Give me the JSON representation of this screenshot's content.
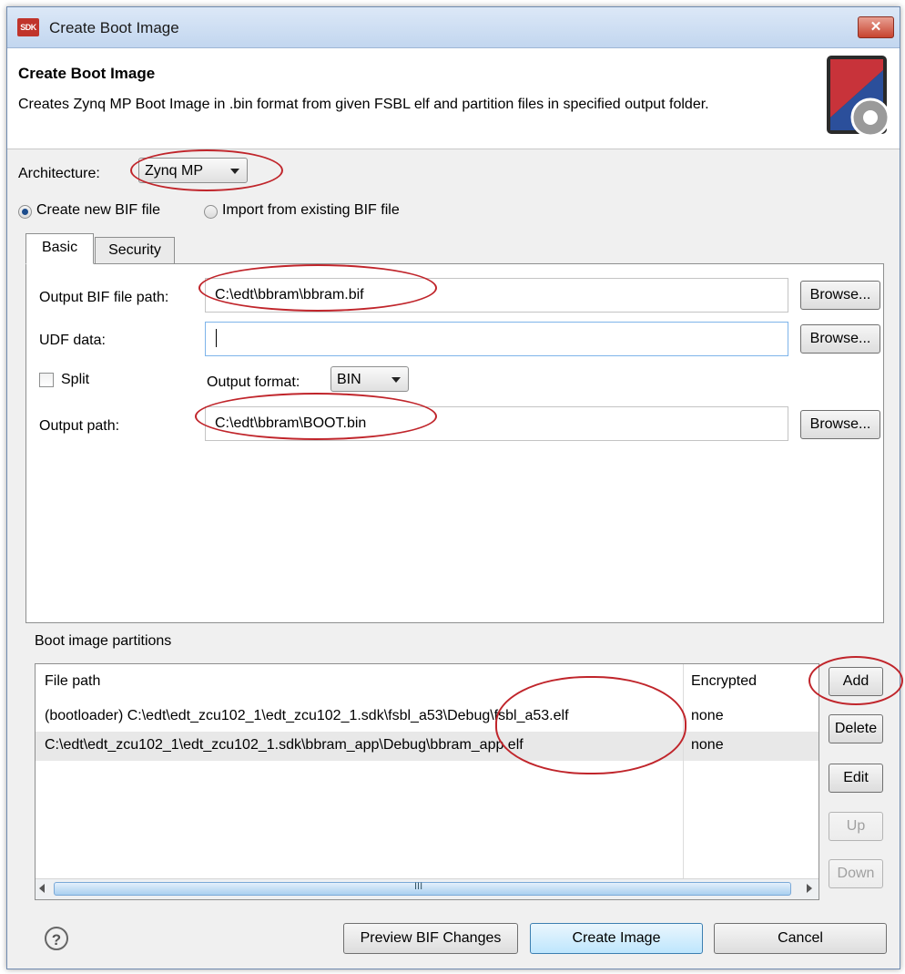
{
  "window": {
    "title": "Create Boot Image",
    "close_label": "✕",
    "app_icon_label": "SDK"
  },
  "header": {
    "title": "Create Boot Image",
    "description": "Creates Zynq MP Boot Image in .bin format from given FSBL elf and partition files in specified output folder."
  },
  "architecture": {
    "label": "Architecture:",
    "value": "Zynq MP"
  },
  "bif_mode": {
    "options": [
      {
        "label": "Create new BIF file",
        "selected": true
      },
      {
        "label": "Import from existing BIF file",
        "selected": false
      }
    ]
  },
  "tabs": [
    {
      "label": "Basic",
      "active": true
    },
    {
      "label": "Security",
      "active": false
    }
  ],
  "basic": {
    "output_bif": {
      "label": "Output BIF file path:",
      "value": "C:\\edt\\bbram\\bbram.bif",
      "browse": "Browse..."
    },
    "udf": {
      "label": "UDF data:",
      "value": "",
      "browse": "Browse..."
    },
    "split": {
      "label": "Split",
      "checked": false
    },
    "output_format": {
      "label": "Output format:",
      "value": "BIN"
    },
    "output_path": {
      "label": "Output path:",
      "value": "C:\\edt\\bbram\\BOOT.bin",
      "browse": "Browse..."
    }
  },
  "partitions": {
    "section_label": "Boot image partitions",
    "columns": [
      "File path",
      "Encrypted"
    ],
    "rows": [
      {
        "path": "(bootloader) C:\\edt\\edt_zcu102_1\\edt_zcu102_1.sdk\\fsbl_a53\\Debug\\fsbl_a53.elf",
        "encrypted": "none"
      },
      {
        "path": "C:\\edt\\edt_zcu102_1\\edt_zcu102_1.sdk\\bbram_app\\Debug\\bbram_app.elf",
        "encrypted": "none"
      }
    ],
    "buttons": {
      "add": "Add",
      "delete": "Delete",
      "edit": "Edit",
      "up": "Up",
      "down": "Down"
    },
    "scroll_grip": "III"
  },
  "footer": {
    "help": "?",
    "preview": "Preview BIF Changes",
    "create": "Create Image",
    "cancel": "Cancel"
  },
  "colors": {
    "annotation_ring": "#c0252b",
    "title_bar": "#c2d6ef",
    "selected_row": "#e8e8e8"
  }
}
